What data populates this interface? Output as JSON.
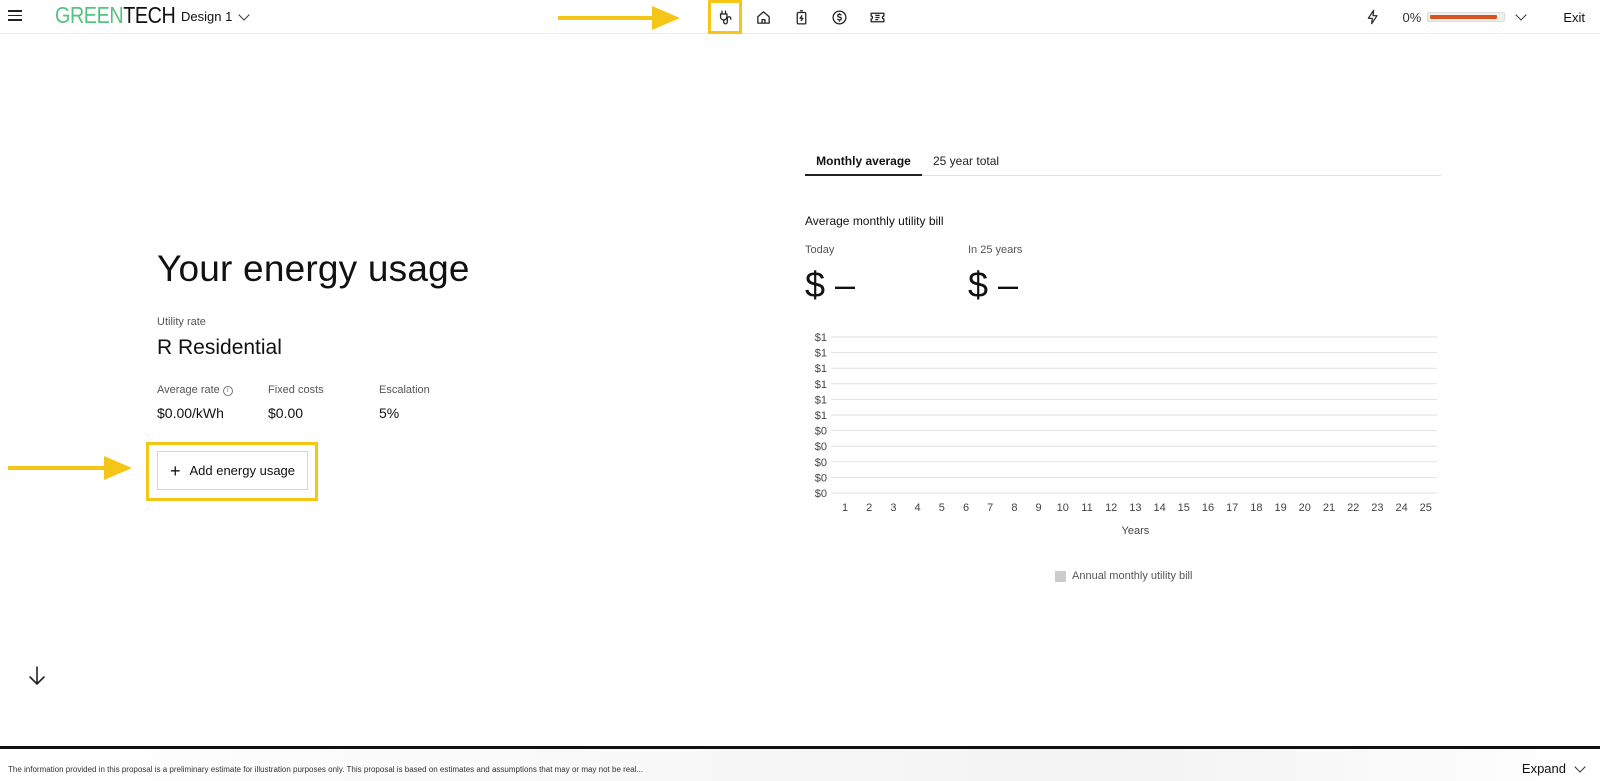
{
  "header": {
    "brand_part1": "GREEN",
    "brand_part2": "TECH",
    "design_label": "Design 1",
    "nav_icons": [
      "plug-icon",
      "home-icon",
      "battery-icon",
      "dollar-icon",
      "receipt-icon"
    ],
    "progress_percent_label": "0%",
    "progress_fraction": 0.9,
    "exit_label": "Exit"
  },
  "main": {
    "title": "Your energy usage",
    "utility_rate_label": "Utility rate",
    "utility_rate_value": "R Residential",
    "metrics": [
      {
        "label": "Average rate",
        "value": "$0.00/kWh"
      },
      {
        "label": "Fixed costs",
        "value": "$0.00"
      },
      {
        "label": "Escalation",
        "value": "5%"
      }
    ],
    "add_button_label": "Add energy usage"
  },
  "panel": {
    "tabs": [
      {
        "label": "Monthly average",
        "active": true
      },
      {
        "label": "25 year total",
        "active": false
      }
    ],
    "bill_title": "Average monthly utility bill",
    "today_label": "Today",
    "today_value": "$ –",
    "future_label": "In 25 years",
    "future_value": "$ –"
  },
  "chart_data": {
    "type": "bar",
    "categories": [
      "1",
      "2",
      "3",
      "4",
      "5",
      "6",
      "7",
      "8",
      "9",
      "10",
      "11",
      "12",
      "13",
      "14",
      "15",
      "16",
      "17",
      "18",
      "19",
      "20",
      "21",
      "22",
      "23",
      "24",
      "25"
    ],
    "series": [
      {
        "name": "Annual monthly utility bill",
        "values": []
      }
    ],
    "y_tick_labels": [
      "$1",
      "$1",
      "$1",
      "$1",
      "$1",
      "$1",
      "$0",
      "$0",
      "$0",
      "$0",
      "$0"
    ],
    "xlabel": "Years",
    "ylabel": "",
    "grid": true,
    "legend_placement": "bottom-center",
    "colors": {
      "series": "#cccccc",
      "grid": "#e2e2e2"
    }
  },
  "footer": {
    "disclaimer": "The information provided in this proposal is a preliminary estimate for illustration purposes only. This proposal is based on estimates and assumptions that may or may not be real...",
    "expand_label": "Expand"
  },
  "colors": {
    "brand_green": "#54c37f",
    "highlight_yellow": "#f5c518",
    "progress_orange": "#d9531e"
  }
}
